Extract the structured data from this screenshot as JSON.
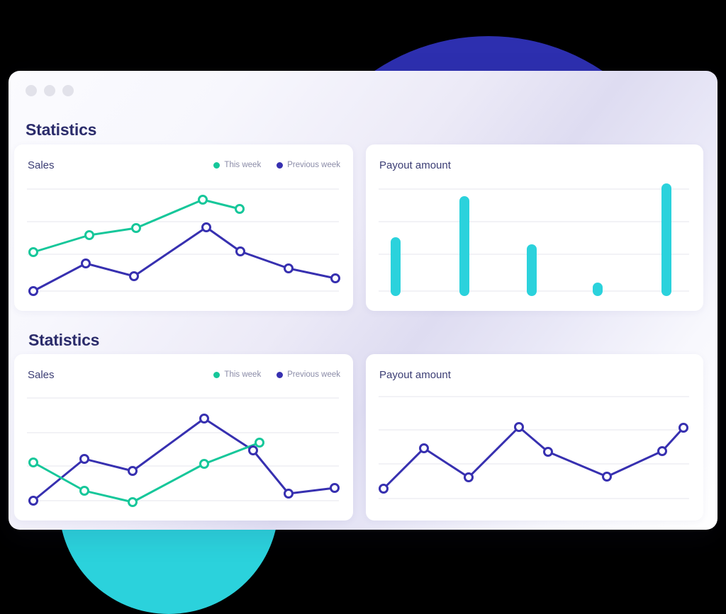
{
  "window": {
    "traffic_lights": [
      "close-dot",
      "minimize-dot",
      "maximize-dot"
    ]
  },
  "sections": [
    {
      "title": "Statistics"
    },
    {
      "title": "Statistics"
    }
  ],
  "cards": {
    "top_left": {
      "title": "Sales"
    },
    "top_right": {
      "title": "Payout amount"
    },
    "bottom_left": {
      "title": "Sales"
    },
    "bottom_right": {
      "title": "Payout amount"
    }
  },
  "legend": {
    "this_week": "This week",
    "previous_week": "Previous week"
  },
  "colors": {
    "teal": "#16C79A",
    "indigo": "#3730B0",
    "cyan": "#2BD2DC",
    "blob_indigo": "#2D2FAF",
    "blob_cyan": "#2BD2DC",
    "gridline": "#e6e6ee",
    "title": "#2b2c6b",
    "card_title": "#3b3d74",
    "legend_text": "#8b8ca8",
    "traffic_light": "#e2e2ea"
  },
  "chart_data": [
    {
      "id": "sales-top",
      "type": "line",
      "title": "Sales",
      "xlabel": "",
      "ylabel": "",
      "grid": true,
      "gridlines": 4,
      "legend_position": "top-right",
      "x": [
        1,
        2,
        3,
        4,
        5,
        6,
        7,
        8
      ],
      "ylim": [
        0,
        100
      ],
      "series": [
        {
          "name": "This week",
          "color": "#16C79A",
          "values": [
            36,
            60,
            66,
            85,
            76,
            null,
            null,
            null
          ]
        },
        {
          "name": "Previous week",
          "color": "#3730B0",
          "values": [
            4,
            41,
            26,
            69,
            51,
            38,
            27,
            null
          ]
        }
      ]
    },
    {
      "id": "payout-top",
      "type": "bar",
      "title": "Payout amount",
      "xlabel": "",
      "ylabel": "",
      "grid": true,
      "gridlines": 4,
      "categories": [
        "1",
        "2",
        "3",
        "4",
        "5"
      ],
      "values": [
        53,
        91,
        42,
        4,
        98
      ],
      "ylim": [
        0,
        100
      ],
      "color": "#2BD2DC"
    },
    {
      "id": "sales-bottom",
      "type": "line",
      "title": "Sales",
      "xlabel": "",
      "ylabel": "",
      "grid": true,
      "gridlines": 4,
      "legend_position": "top-right",
      "x": [
        1,
        2,
        3,
        4,
        5,
        6,
        7,
        8
      ],
      "ylim": [
        0,
        100
      ],
      "series": [
        {
          "name": "This week",
          "color": "#16C79A",
          "values": [
            37,
            16,
            5,
            null,
            34,
            55,
            null,
            null
          ]
        },
        {
          "name": "Previous week",
          "color": "#3730B0",
          "values": [
            4,
            40,
            30,
            80,
            null,
            51,
            12,
            18
          ]
        }
      ]
    },
    {
      "id": "payout-bottom",
      "type": "line",
      "title": "Payout amount",
      "xlabel": "",
      "ylabel": "",
      "grid": true,
      "gridlines": 4,
      "x": [
        1,
        2,
        3,
        4,
        5,
        6,
        7,
        8
      ],
      "ylim": [
        0,
        100
      ],
      "series": [
        {
          "name": "Payout",
          "color": "#3730B0",
          "values": [
            10,
            49,
            24,
            73,
            44,
            26,
            45,
            72
          ]
        }
      ]
    }
  ]
}
